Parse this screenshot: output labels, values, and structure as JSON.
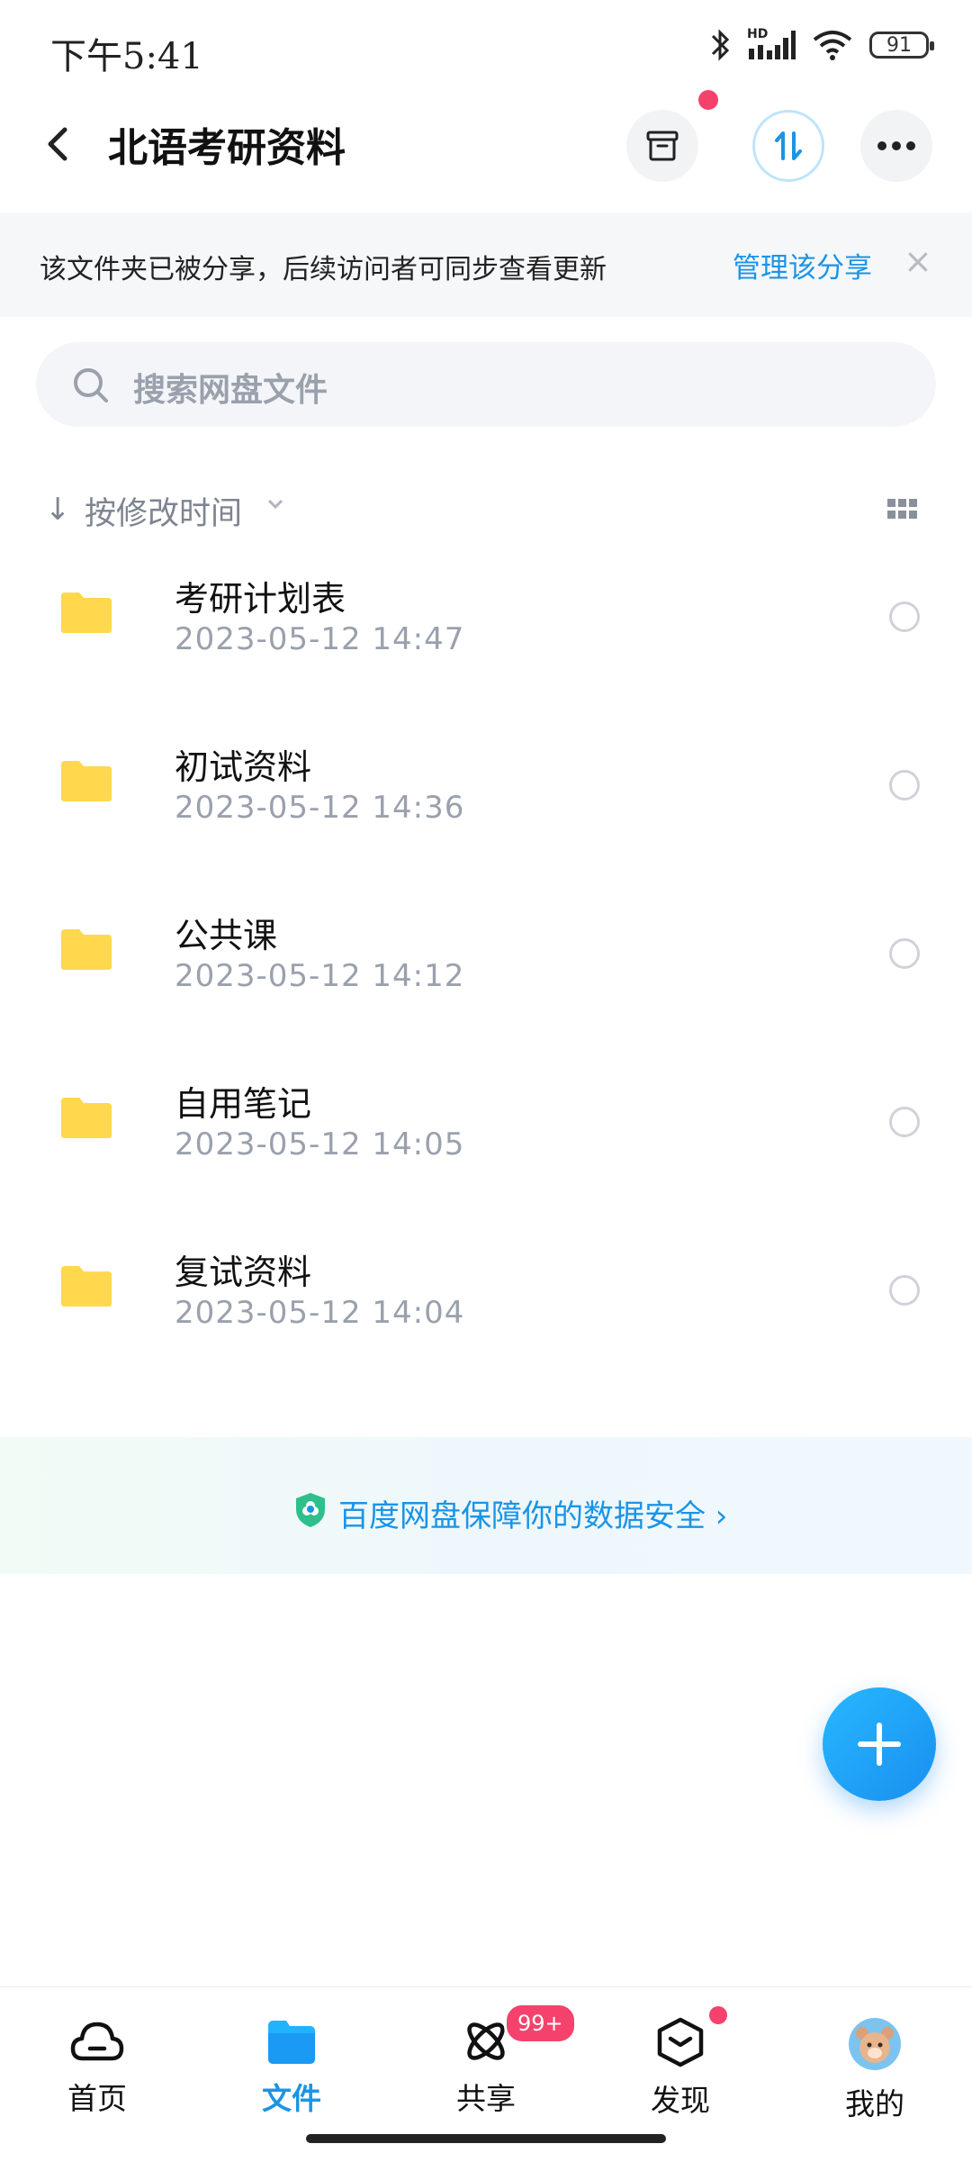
{
  "status_bar": {
    "time": "下午5:41",
    "network_label": "HD",
    "battery": "91"
  },
  "header": {
    "title": "北语考研资料"
  },
  "share_banner": {
    "text": "该文件夹已被分享，后续访问者可同步查看更新",
    "link": "管理该分享",
    "close": "×"
  },
  "search": {
    "placeholder": "搜索网盘文件"
  },
  "sort": {
    "label": "按修改时间"
  },
  "files": [
    {
      "name": "考研计划表",
      "date": "2023-05-12  14:47"
    },
    {
      "name": "初试资料",
      "date": "2023-05-12  14:36"
    },
    {
      "name": "公共课",
      "date": "2023-05-12  14:12"
    },
    {
      "name": "自用笔记",
      "date": "2023-05-12  14:05"
    },
    {
      "name": "复试资料",
      "date": "2023-05-12  14:04"
    }
  ],
  "safety_text": "百度网盘保障你的数据安全 ›",
  "nav": {
    "items": [
      {
        "label": "首页"
      },
      {
        "label": "文件"
      },
      {
        "label": "共享"
      },
      {
        "label": "发现"
      },
      {
        "label": "我的"
      }
    ],
    "share_badge": "99+"
  },
  "colors": {
    "accent": "#1b94e6",
    "badge": "#f5426c",
    "folder": "#ffd84d"
  }
}
